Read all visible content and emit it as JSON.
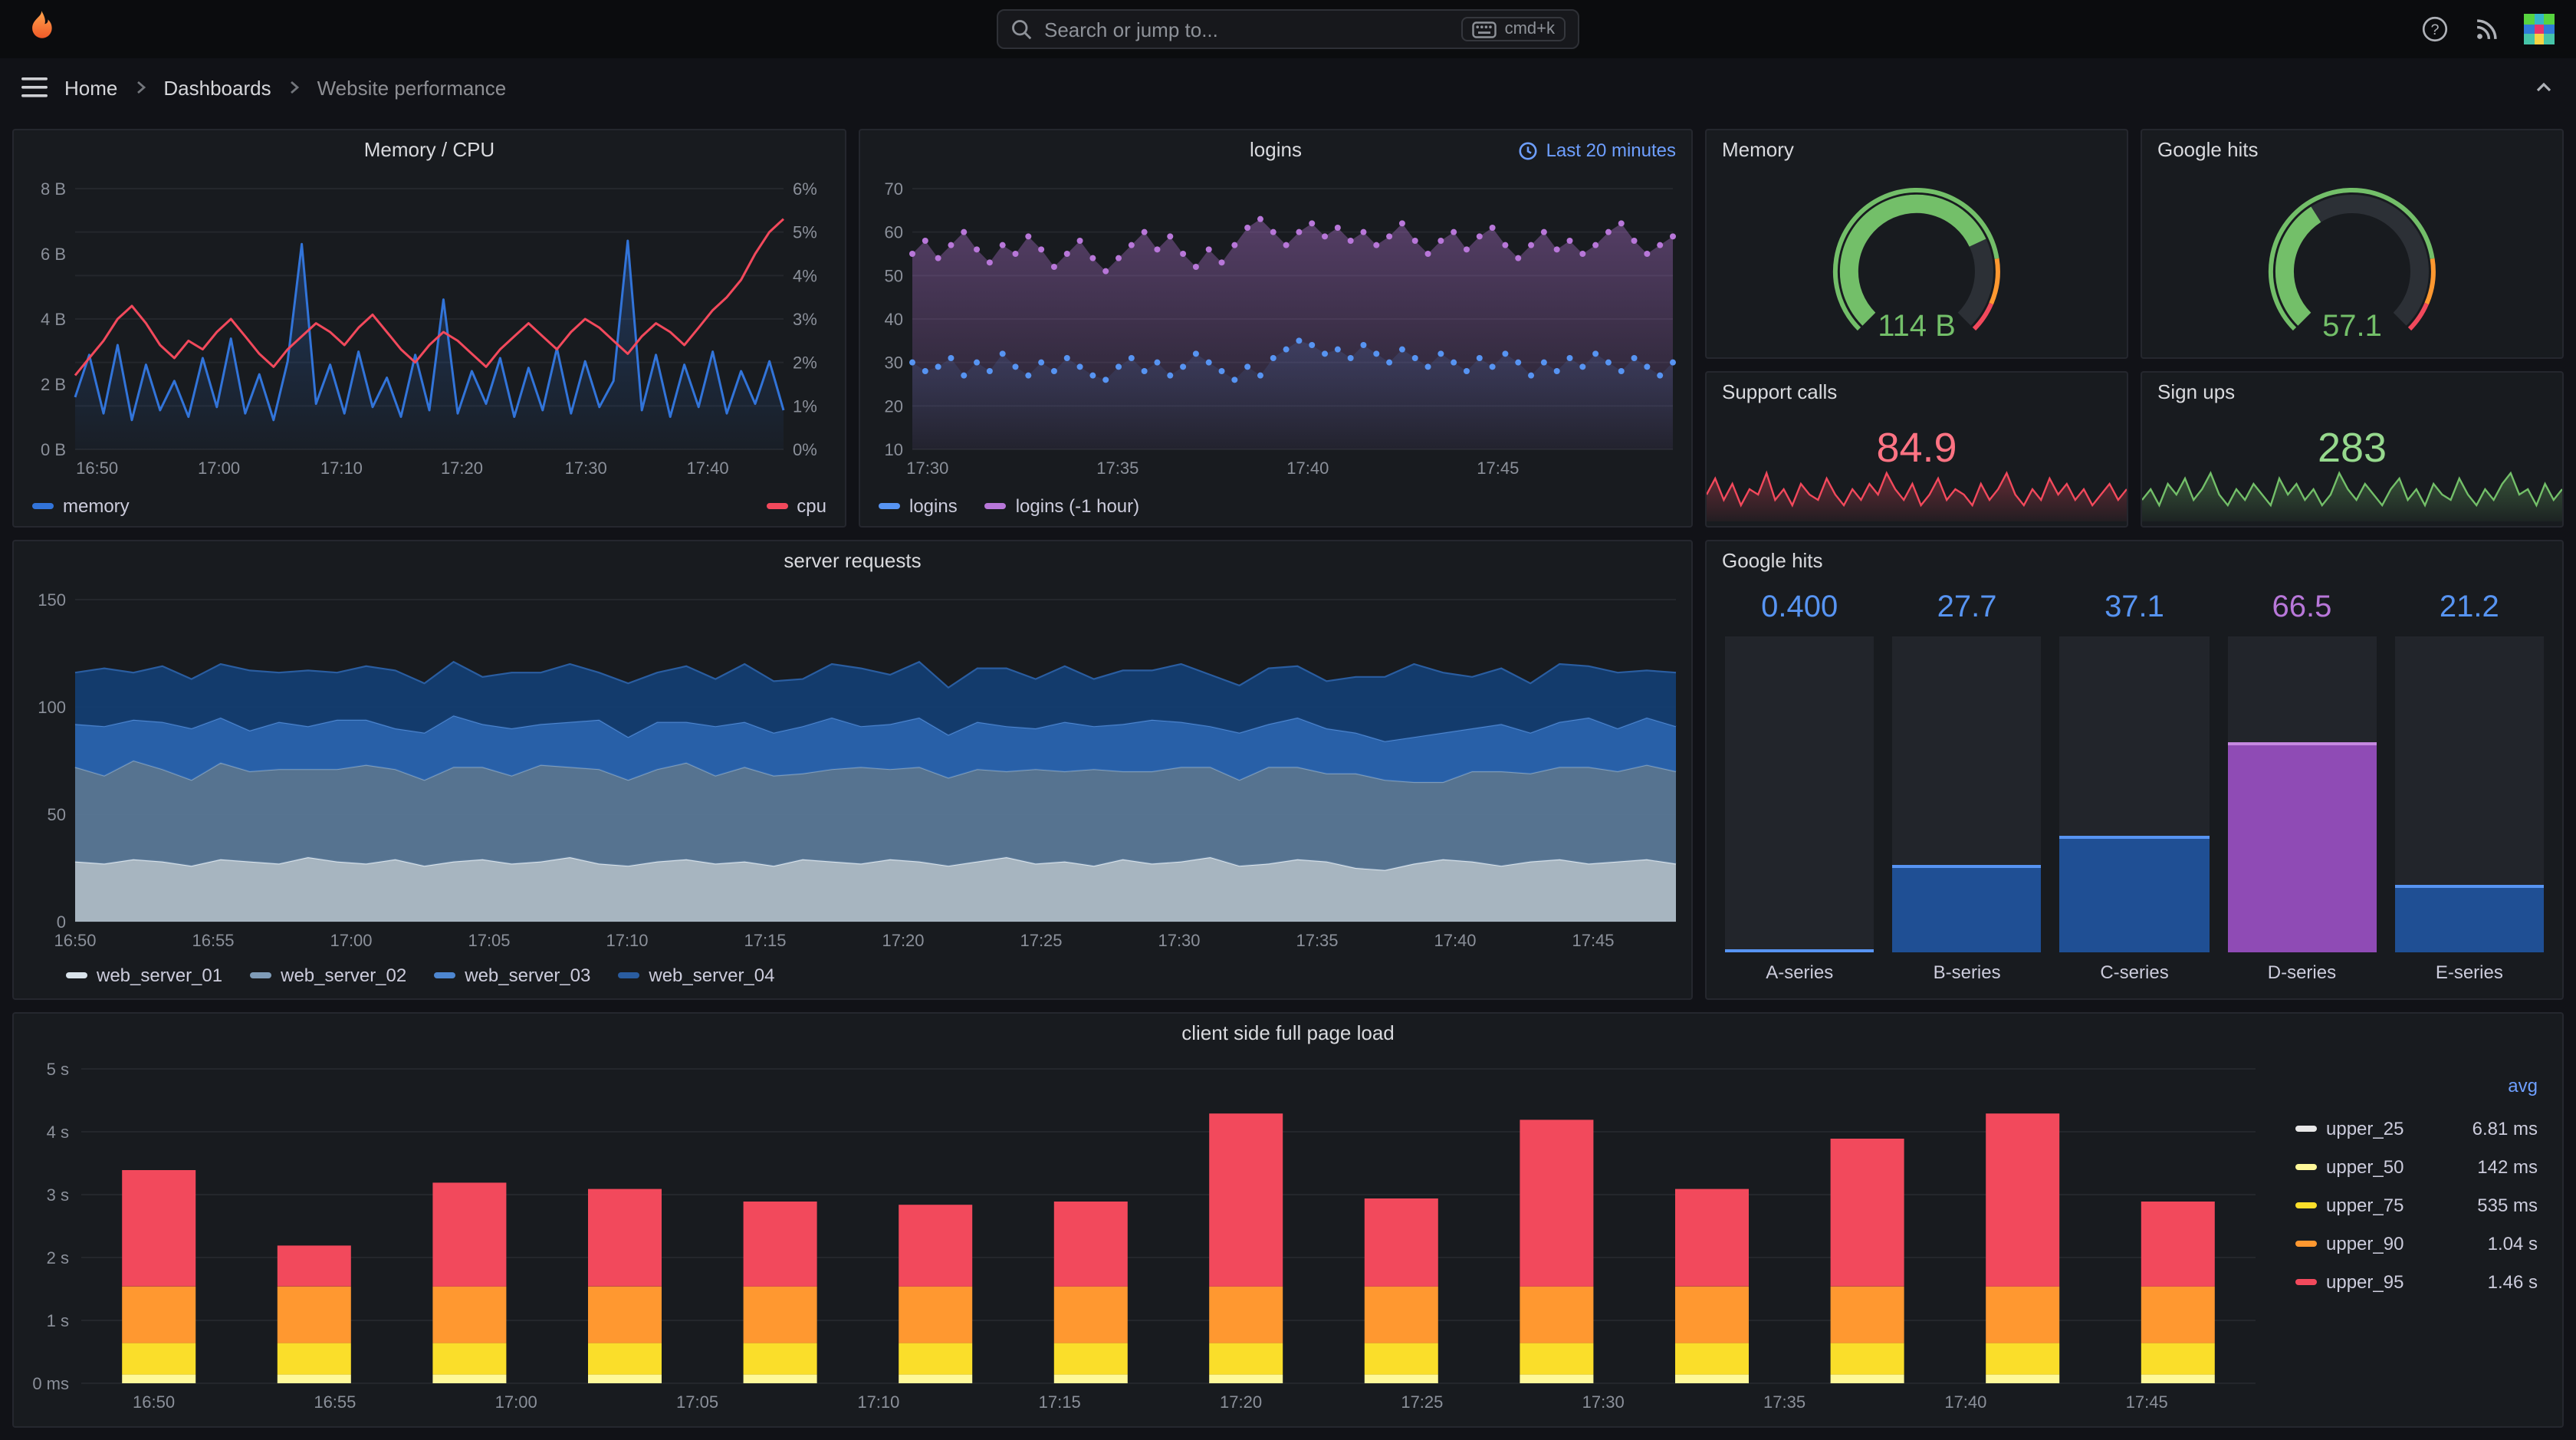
{
  "topbar": {
    "search_placeholder": "Search or jump to...",
    "shortcut_label": "cmd+k"
  },
  "breadcrumb": {
    "items": [
      "Home",
      "Dashboards",
      "Website performance"
    ]
  },
  "chart_data": [
    {
      "id": "memcpu",
      "type": "line",
      "title": "Memory / CPU",
      "x_ticks": [
        "16:50",
        "17:00",
        "17:10",
        "17:20",
        "17:30",
        "17:40"
      ],
      "x_tick_fractions": [
        0.005,
        0.177,
        0.35,
        0.52,
        0.695,
        0.867
      ],
      "axes": {
        "left": {
          "ticks": [
            "0 B",
            "2 B",
            "4 B",
            "6 B",
            "8 B"
          ],
          "max": 8
        },
        "right": {
          "ticks": [
            "0%",
            "1%",
            "2%",
            "3%",
            "4%",
            "5%",
            "6%"
          ],
          "max": 6
        }
      },
      "series": [
        {
          "name": "memory",
          "color": "#3274d9",
          "axis": "left",
          "values": [
            1.6,
            2.9,
            1.1,
            3.2,
            0.9,
            2.6,
            1.2,
            2.1,
            1.0,
            2.8,
            1.3,
            3.4,
            1.1,
            2.3,
            0.9,
            2.7,
            6.3,
            1.4,
            2.6,
            1.1,
            3.0,
            1.3,
            2.2,
            1.0,
            2.9,
            1.2,
            4.6,
            1.1,
            2.4,
            1.4,
            2.8,
            1.0,
            2.5,
            1.2,
            3.1,
            1.1,
            2.7,
            1.3,
            2.1,
            6.4,
            1.2,
            2.9,
            1.0,
            2.6,
            1.3,
            3.0,
            1.1,
            2.4,
            1.4,
            2.7,
            1.2
          ]
        },
        {
          "name": "cpu",
          "color": "#f2495c",
          "axis": "right",
          "values": [
            1.7,
            2.1,
            2.5,
            3.0,
            3.3,
            2.9,
            2.4,
            2.1,
            2.5,
            2.3,
            2.7,
            3.0,
            2.6,
            2.2,
            1.9,
            2.3,
            2.6,
            2.9,
            2.7,
            2.4,
            2.8,
            3.1,
            2.7,
            2.3,
            2.0,
            2.4,
            2.7,
            2.5,
            2.2,
            1.9,
            2.3,
            2.6,
            2.9,
            2.6,
            2.3,
            2.7,
            3.0,
            2.8,
            2.5,
            2.2,
            2.6,
            2.9,
            2.7,
            2.4,
            2.8,
            3.2,
            3.5,
            3.9,
            4.5,
            5.0,
            5.3
          ]
        }
      ]
    },
    {
      "id": "logins",
      "type": "scatter",
      "title": "logins",
      "time_label": "Last 20 minutes",
      "x_ticks": [
        "17:30",
        "17:35",
        "17:40",
        "17:45"
      ],
      "x_tick_fractions": [
        0.02,
        0.27,
        0.52,
        0.77
      ],
      "y": {
        "min": 10,
        "max": 70,
        "ticks": [
          10,
          20,
          30,
          40,
          50,
          60,
          70
        ]
      },
      "series": [
        {
          "name": "logins",
          "color": "#5794f2",
          "values": [
            30,
            28,
            29,
            31,
            27,
            30,
            28,
            32,
            29,
            27,
            30,
            28,
            31,
            29,
            27,
            26,
            29,
            31,
            28,
            30,
            27,
            29,
            32,
            30,
            28,
            26,
            29,
            27,
            31,
            33,
            35,
            34,
            32,
            33,
            31,
            34,
            32,
            30,
            33,
            31,
            29,
            32,
            30,
            28,
            31,
            29,
            32,
            30,
            27,
            30,
            28,
            31,
            29,
            32,
            30,
            28,
            31,
            29,
            27,
            30
          ]
        },
        {
          "name": "logins (-1 hour)",
          "color": "#b877d9",
          "area": true,
          "values": [
            55,
            58,
            54,
            57,
            60,
            56,
            53,
            57,
            55,
            59,
            56,
            52,
            55,
            58,
            54,
            51,
            54,
            57,
            60,
            56,
            59,
            55,
            52,
            56,
            53,
            57,
            61,
            63,
            60,
            57,
            60,
            62,
            59,
            61,
            58,
            60,
            57,
            59,
            62,
            58,
            55,
            58,
            60,
            56,
            59,
            61,
            57,
            54,
            57,
            60,
            56,
            58,
            55,
            57,
            60,
            62,
            58,
            55,
            57,
            59
          ]
        }
      ]
    },
    {
      "id": "memory_gauge",
      "type": "gauge",
      "title": "Memory",
      "value": "114 B",
      "fraction": 0.74,
      "color": "#73bf69",
      "thresholds": [
        {
          "color": "#73bf69",
          "to": 0.8
        },
        {
          "color": "#ff9830",
          "to": 0.92
        },
        {
          "color": "#f2495c",
          "to": 1
        }
      ]
    },
    {
      "id": "google_hits_gauge",
      "type": "gauge",
      "title": "Google hits",
      "value": "57.1",
      "fraction": 0.38,
      "color": "#73bf69",
      "thresholds": [
        {
          "color": "#73bf69",
          "to": 0.8
        },
        {
          "color": "#ff9830",
          "to": 0.92
        },
        {
          "color": "#f2495c",
          "to": 1
        }
      ]
    },
    {
      "id": "support_calls",
      "type": "stat",
      "title": "Support calls",
      "value": "84.9",
      "color": "#ff7383",
      "line_color": "#f2495c",
      "values": [
        0.5,
        0.8,
        0.4,
        0.7,
        0.3,
        0.6,
        0.5,
        0.9,
        0.4,
        0.6,
        0.3,
        0.7,
        0.5,
        0.4,
        0.8,
        0.5,
        0.3,
        0.6,
        0.4,
        0.7,
        0.5,
        0.9,
        0.6,
        0.4,
        0.7,
        0.3,
        0.5,
        0.8,
        0.4,
        0.6,
        0.5,
        0.3,
        0.7,
        0.4,
        0.6,
        0.9,
        0.5,
        0.3,
        0.6,
        0.4,
        0.8,
        0.5,
        0.7,
        0.4,
        0.6,
        0.3,
        0.5,
        0.7,
        0.4,
        0.6
      ]
    },
    {
      "id": "sign_ups",
      "type": "stat",
      "title": "Sign ups",
      "value": "283",
      "color": "#96d98d",
      "line_color": "#73bf69",
      "values": [
        0.4,
        0.6,
        0.3,
        0.7,
        0.5,
        0.8,
        0.4,
        0.6,
        0.9,
        0.5,
        0.3,
        0.6,
        0.4,
        0.7,
        0.5,
        0.3,
        0.8,
        0.5,
        0.7,
        0.4,
        0.6,
        0.3,
        0.5,
        0.9,
        0.6,
        0.4,
        0.7,
        0.5,
        0.3,
        0.6,
        0.8,
        0.4,
        0.6,
        0.3,
        0.7,
        0.5,
        0.4,
        0.8,
        0.5,
        0.3,
        0.6,
        0.4,
        0.7,
        0.9,
        0.5,
        0.6,
        0.3,
        0.7,
        0.4,
        0.6
      ]
    },
    {
      "id": "server_requests",
      "type": "area-stack",
      "title": "server requests",
      "x_ticks": [
        "16:50",
        "16:55",
        "17:00",
        "17:05",
        "17:10",
        "17:15",
        "17:20",
        "17:25",
        "17:30",
        "17:35",
        "17:40",
        "17:45"
      ],
      "y": {
        "max": 150,
        "ticks": [
          0,
          50,
          100,
          150
        ]
      },
      "series": [
        {
          "name": "web_server_01",
          "fill": "#b4c2ce",
          "line": "#d9e3eb",
          "values": [
            28,
            27,
            29,
            28,
            26,
            29,
            28,
            27,
            30,
            28,
            27,
            29,
            26,
            28,
            29,
            27,
            28,
            30,
            27,
            26,
            28,
            29,
            27,
            28,
            26,
            29,
            28,
            27,
            29,
            28,
            26,
            28,
            30,
            27,
            28,
            26,
            29,
            27,
            28,
            30,
            26,
            27,
            29,
            28,
            25,
            24,
            27,
            29,
            28,
            26,
            28,
            29,
            27,
            28,
            29,
            27
          ]
        },
        {
          "name": "web_server_02",
          "fill": "#5c7b9a",
          "line": "#7f9cb8",
          "values": [
            44,
            41,
            46,
            43,
            40,
            45,
            42,
            44,
            41,
            43,
            46,
            42,
            40,
            44,
            43,
            41,
            45,
            42,
            44,
            40,
            43,
            45,
            41,
            44,
            42,
            40,
            43,
            45,
            42,
            44,
            41,
            43,
            40,
            44,
            42,
            45,
            41,
            43,
            44,
            42,
            40,
            45,
            43,
            41,
            44,
            42,
            38,
            36,
            42,
            44,
            41,
            43,
            45,
            42,
            44,
            43
          ]
        },
        {
          "name": "web_server_03",
          "fill": "#2a66b4",
          "line": "#4d86d0",
          "values": [
            20,
            23,
            19,
            22,
            24,
            21,
            19,
            22,
            20,
            23,
            21,
            19,
            22,
            24,
            20,
            22,
            19,
            21,
            23,
            20,
            22,
            19,
            23,
            21,
            20,
            22,
            24,
            19,
            21,
            23,
            20,
            22,
            21,
            19,
            23,
            20,
            22,
            24,
            21,
            19,
            22,
            20,
            23,
            21,
            19,
            18,
            21,
            23,
            20,
            22,
            19,
            21,
            23,
            20,
            22,
            21
          ]
        },
        {
          "name": "web_server_04",
          "fill": "#143e73",
          "line": "#2a5da0",
          "values": [
            24,
            27,
            22,
            26,
            23,
            25,
            28,
            23,
            26,
            22,
            25,
            27,
            23,
            25,
            22,
            26,
            24,
            27,
            22,
            25,
            23,
            26,
            22,
            27,
            24,
            22,
            25,
            27,
            23,
            26,
            22,
            25,
            27,
            23,
            26,
            22,
            25,
            23,
            27,
            24,
            22,
            26,
            24,
            22,
            26,
            30,
            34,
            28,
            24,
            26,
            23,
            27,
            24,
            26,
            22,
            25
          ]
        }
      ]
    },
    {
      "id": "google_hits_bars",
      "type": "bar-gauge",
      "title": "Google hits",
      "max": 100,
      "bars": [
        {
          "label": "A-series",
          "value": "0.400",
          "num": 0.4,
          "value_color": "#5794f2",
          "fill": "#1f4f94",
          "edge": "#5794f2"
        },
        {
          "label": "B-series",
          "value": "27.7",
          "num": 27.7,
          "value_color": "#5794f2",
          "fill": "#1f4f94",
          "edge": "#5794f2"
        },
        {
          "label": "C-series",
          "value": "37.1",
          "num": 37.1,
          "value_color": "#5794f2",
          "fill": "#1f4f94",
          "edge": "#5794f2"
        },
        {
          "label": "D-series",
          "value": "66.5",
          "num": 66.5,
          "value_color": "#b877d9",
          "fill": "#8f4bb5",
          "edge": "#c588e0"
        },
        {
          "label": "E-series",
          "value": "21.2",
          "num": 21.2,
          "value_color": "#5794f2",
          "fill": "#1f4f94",
          "edge": "#5794f2"
        }
      ]
    },
    {
      "id": "page_load",
      "type": "bar-stack",
      "title": "client side full page load",
      "legend_header": "avg",
      "x_ticks": [
        "16:50",
        "16:55",
        "17:00",
        "17:05",
        "17:10",
        "17:15",
        "17:20",
        "17:25",
        "17:30",
        "17:35",
        "17:40",
        "17:45"
      ],
      "y": {
        "max": 5,
        "ticks": [
          "0 ms",
          "1 s",
          "2 s",
          "3 s",
          "4 s",
          "5 s"
        ]
      },
      "series": [
        {
          "name": "upper_25",
          "avg": "6.81 ms",
          "color": "#e8e8e8",
          "values": [
            0.007,
            0.007,
            0.007,
            0.007,
            0.007,
            0.007,
            0.007,
            0.007,
            0.007,
            0.007,
            0.007,
            0.007,
            0.007,
            0.007
          ]
        },
        {
          "name": "upper_50",
          "avg": "142 ms",
          "color": "#fff899",
          "values": [
            0.14,
            0.14,
            0.14,
            0.14,
            0.14,
            0.14,
            0.14,
            0.14,
            0.14,
            0.14,
            0.14,
            0.14,
            0.14,
            0.14
          ]
        },
        {
          "name": "upper_75",
          "avg": "535 ms",
          "color": "#fade2a",
          "values": [
            0.5,
            0.5,
            0.5,
            0.5,
            0.5,
            0.5,
            0.5,
            0.5,
            0.5,
            0.5,
            0.5,
            0.5,
            0.5,
            0.5
          ]
        },
        {
          "name": "upper_90",
          "avg": "1.04 s",
          "color": "#ff9830",
          "values": [
            0.9,
            0.9,
            0.9,
            0.9,
            0.9,
            0.9,
            0.9,
            0.9,
            0.9,
            0.9,
            0.9,
            0.9,
            0.9,
            0.9
          ]
        },
        {
          "name": "upper_95",
          "avg": "1.46 s",
          "color": "#f2495c",
          "values": [
            1.85,
            0.65,
            1.65,
            1.55,
            1.35,
            1.3,
            1.35,
            2.75,
            1.4,
            2.65,
            1.55,
            2.35,
            2.75,
            1.35
          ]
        }
      ]
    }
  ]
}
